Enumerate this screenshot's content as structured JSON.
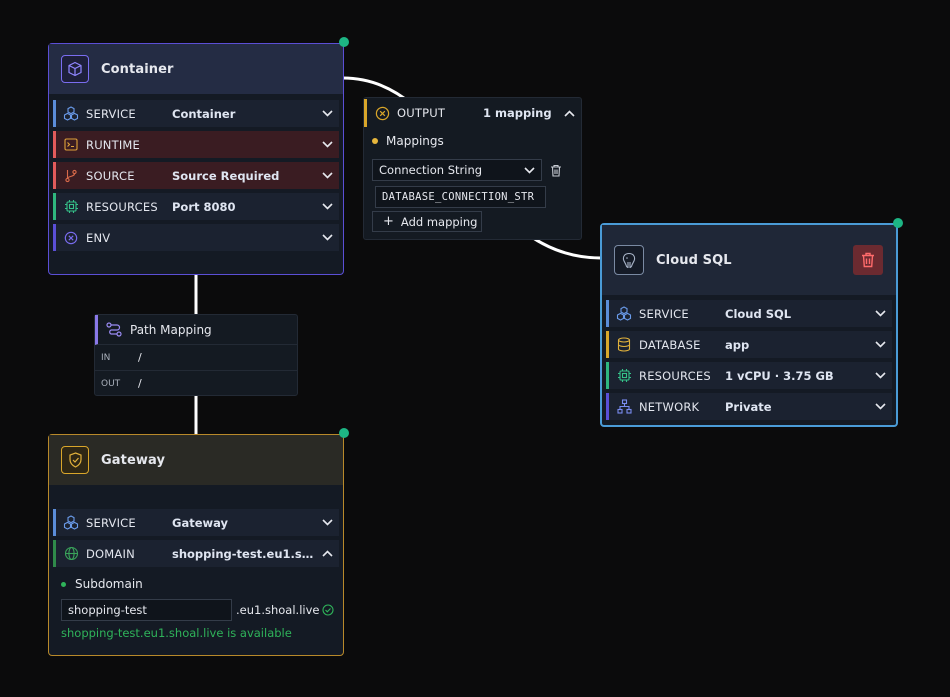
{
  "container": {
    "title": "Container",
    "rows": [
      {
        "label": "SERVICE",
        "value": "Container"
      },
      {
        "label": "RUNTIME",
        "value": ""
      },
      {
        "label": "SOURCE",
        "value": "Source Required"
      },
      {
        "label": "RESOURCES",
        "value": "Port 8080"
      },
      {
        "label": "ENV",
        "value": ""
      }
    ]
  },
  "output": {
    "label": "OUTPUT",
    "count": "1 mapping",
    "mappings_label": "Mappings",
    "select_value": "Connection String",
    "env_var": "DATABASE_CONNECTION_STR",
    "add_label": "Add mapping"
  },
  "path_mapping": {
    "title": "Path Mapping",
    "in_label": "IN",
    "in_value": "/",
    "out_label": "OUT",
    "out_value": "/"
  },
  "gateway": {
    "title": "Gateway",
    "rows": [
      {
        "label": "SERVICE",
        "value": "Gateway"
      },
      {
        "label": "DOMAIN",
        "value": "shopping-test.eu1.shoal.live"
      }
    ],
    "subdomain_label": "Subdomain",
    "subdomain_value": "shopping-test",
    "suffix": ".eu1.shoal.live",
    "available_msg": "shopping-test.eu1.shoal.live is available"
  },
  "cloudsql": {
    "title": "Cloud SQL",
    "rows": [
      {
        "label": "SERVICE",
        "value": "Cloud SQL"
      },
      {
        "label": "DATABASE",
        "value": "app"
      },
      {
        "label": "RESOURCES",
        "value": "1 vCPU · 3.75 GB"
      },
      {
        "label": "NETWORK",
        "value": "Private"
      }
    ]
  },
  "colors": {
    "container_border": "#5b4fd6",
    "gateway_border": "#b8892a",
    "cloudsql_border": "#4a9bd6",
    "status_green": "#1db584",
    "error_red": "#e25b5b"
  }
}
